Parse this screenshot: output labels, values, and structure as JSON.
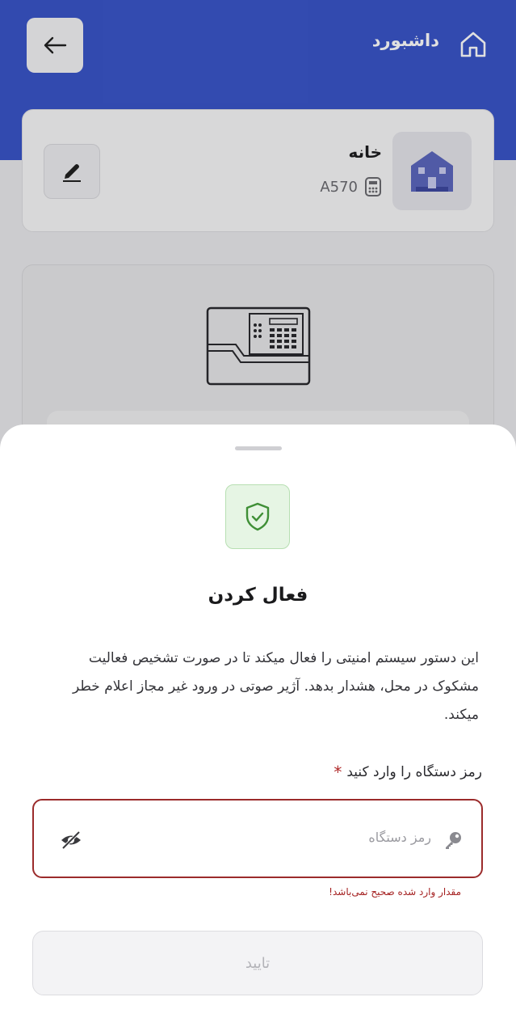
{
  "header": {
    "title": "داشبورد",
    "back_icon": "arrow-left-icon",
    "home_icon": "home-icon"
  },
  "device": {
    "name": "خانه",
    "model": "A570",
    "model_icon": "device-icon",
    "edit_icon": "pencil-icon",
    "house_icon": "house-icon"
  },
  "panel": {
    "illustration": "alarm-panel-icon"
  },
  "sheet": {
    "icon": "shield-check-icon",
    "title": "فعال کردن",
    "description": "این دستور سیستم امنیتی را فعال میکند تا در صورت تشخیص فعالیت مشکوک در محل، هشدار بدهد. آژیر صوتی در ورود غیر مجاز اعلام خطر میکند.",
    "field_label": "رمز دستگاه را وارد کنید",
    "required_mark": "*",
    "password_placeholder": "رمز دستگاه",
    "password_value": "",
    "error": "مقدار وارد شده صحیح نمی‌باشد!",
    "confirm_label": "تایید"
  },
  "colors": {
    "brand_blue": "#3a55c8",
    "error_red": "#9b2b2b",
    "success_green": "#4a9a3f"
  }
}
